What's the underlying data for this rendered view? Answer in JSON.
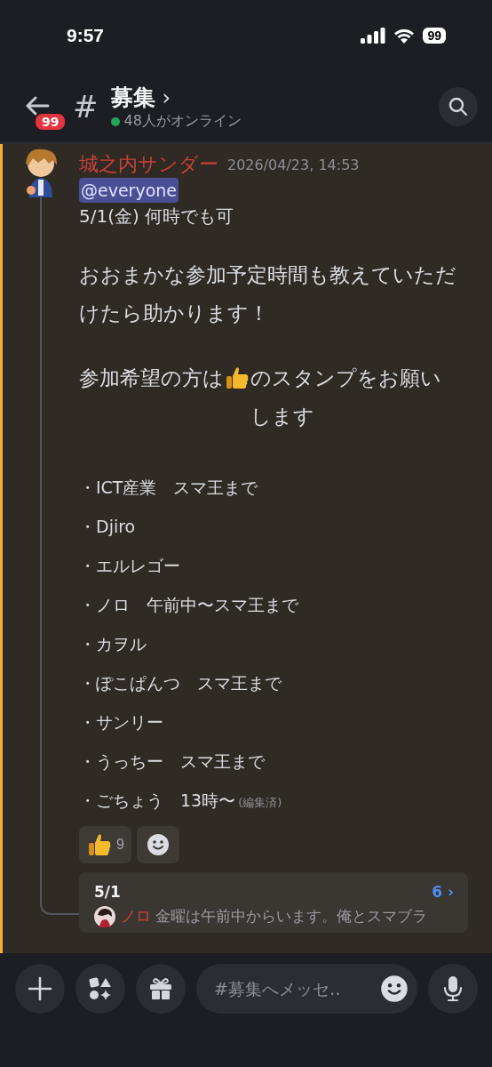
{
  "status_bar": {
    "time": "9:57",
    "battery": "99"
  },
  "header": {
    "unread_badge": "99",
    "channel_prefix": "#",
    "title": "募集",
    "chevron": "›",
    "online": "48人がオンライン"
  },
  "message": {
    "author": "城之内サンダー",
    "timestamp": "2026/04/23, 14:53",
    "mention": "@everyone",
    "date_line": "5/1(金) 何時でも可",
    "paragraph": "おおまかな参加予定時間も教えていただけたら助かります！",
    "request": {
      "before": "参加希望の方は",
      "after": "のスタンプをお願いします"
    },
    "list": [
      {
        "text": "・ICT産業　スマ王まで"
      },
      {
        "text": "・Djiro"
      },
      {
        "text": "・エルレゴー"
      },
      {
        "text": "・ノロ　午前中〜スマ王まで"
      },
      {
        "text": "・カヲル"
      },
      {
        "text": "・ぽこぱんつ　スマ王まで"
      },
      {
        "text": "・サンリー"
      },
      {
        "text": "・うっちー　スマ王まで"
      },
      {
        "text": "・ごちょう　13時〜",
        "edited": "(編集済)"
      }
    ],
    "reactions": [
      {
        "kind": "thumbs",
        "count": "9"
      },
      {
        "kind": "add"
      }
    ],
    "thread": {
      "title": "5/1",
      "count": "6",
      "chevron": "›",
      "reply_author": "ノロ",
      "reply_text": "金曜は午前中からいます。俺とスマブラ"
    }
  },
  "composer": {
    "placeholder": "#募集へメッセ‥"
  }
}
